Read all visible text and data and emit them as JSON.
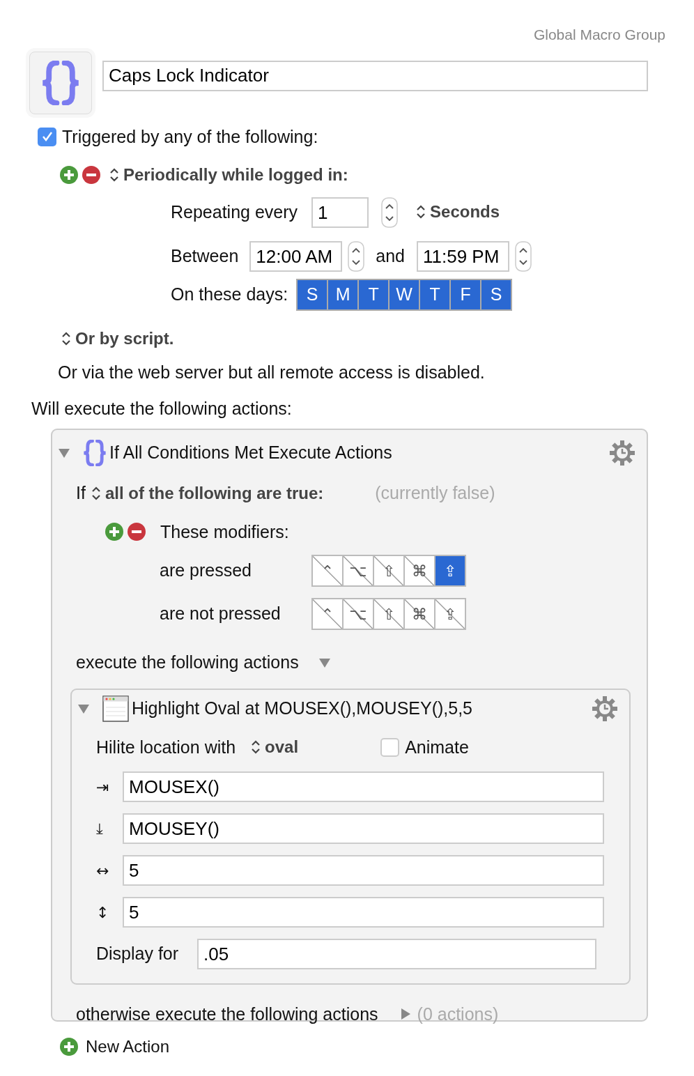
{
  "group": "Global Macro Group",
  "macro": {
    "name": "Caps Lock Indicator"
  },
  "trigger_section": {
    "checked": true,
    "label": "Triggered by any of the following:"
  },
  "trigger": {
    "popup": "Periodically while logged in:",
    "repeat_label": "Repeating every",
    "repeat_value": "1",
    "unit": "Seconds",
    "between_label": "Between",
    "start": "12:00 AM",
    "and_label": "and",
    "end": "11:59 PM",
    "days_label": "On these days:",
    "days": [
      {
        "label": "S",
        "selected": true
      },
      {
        "label": "M",
        "selected": true
      },
      {
        "label": "T",
        "selected": true
      },
      {
        "label": "W",
        "selected": true
      },
      {
        "label": "T",
        "selected": true
      },
      {
        "label": "F",
        "selected": true
      },
      {
        "label": "S",
        "selected": true
      }
    ]
  },
  "script_popup": "Or by script.",
  "web_server": "Or via the web server but all remote access is disabled.",
  "actions_label": "Will execute the following actions:",
  "if_action": {
    "expanded": true,
    "title": "If All Conditions Met Execute Actions",
    "if_label": "If",
    "condition_popup": "all of the following are true:",
    "status": "(currently false)",
    "condition": {
      "label": "These modifiers:",
      "rows": [
        {
          "label": "are pressed",
          "keys": [
            {
              "symbol": "⌃",
              "selected": false
            },
            {
              "symbol": "⌥",
              "selected": false
            },
            {
              "symbol": "⇧",
              "selected": false
            },
            {
              "symbol": "⌘",
              "selected": false
            },
            {
              "symbol": "⇪",
              "selected": true
            }
          ]
        },
        {
          "label": "are not pressed",
          "keys": [
            {
              "symbol": "⌃",
              "selected": false
            },
            {
              "symbol": "⌥",
              "selected": false
            },
            {
              "symbol": "⇧",
              "selected": false
            },
            {
              "symbol": "⌘",
              "selected": false
            },
            {
              "symbol": "⇪",
              "selected": false
            }
          ]
        }
      ]
    },
    "then_label": "execute the following actions",
    "then_expanded": true,
    "action": {
      "expanded": true,
      "title": "Highlight Oval at MOUSEX(),MOUSEY(),5,5",
      "hilite_label": "Hilite location with",
      "shape": "oval",
      "animate": {
        "label": "Animate",
        "checked": false
      },
      "fields": [
        {
          "symbol": "⇥",
          "value": "MOUSEX()"
        },
        {
          "symbol": "⤓",
          "value": "MOUSEY()"
        },
        {
          "symbol": "↔",
          "value": "5"
        },
        {
          "symbol": "↕",
          "value": "5"
        }
      ],
      "display_label": "Display for",
      "display_value": ".05"
    },
    "else_label": "otherwise execute the following actions",
    "else_expanded": false,
    "else_count": "(0 actions)"
  },
  "new_action": "New Action"
}
